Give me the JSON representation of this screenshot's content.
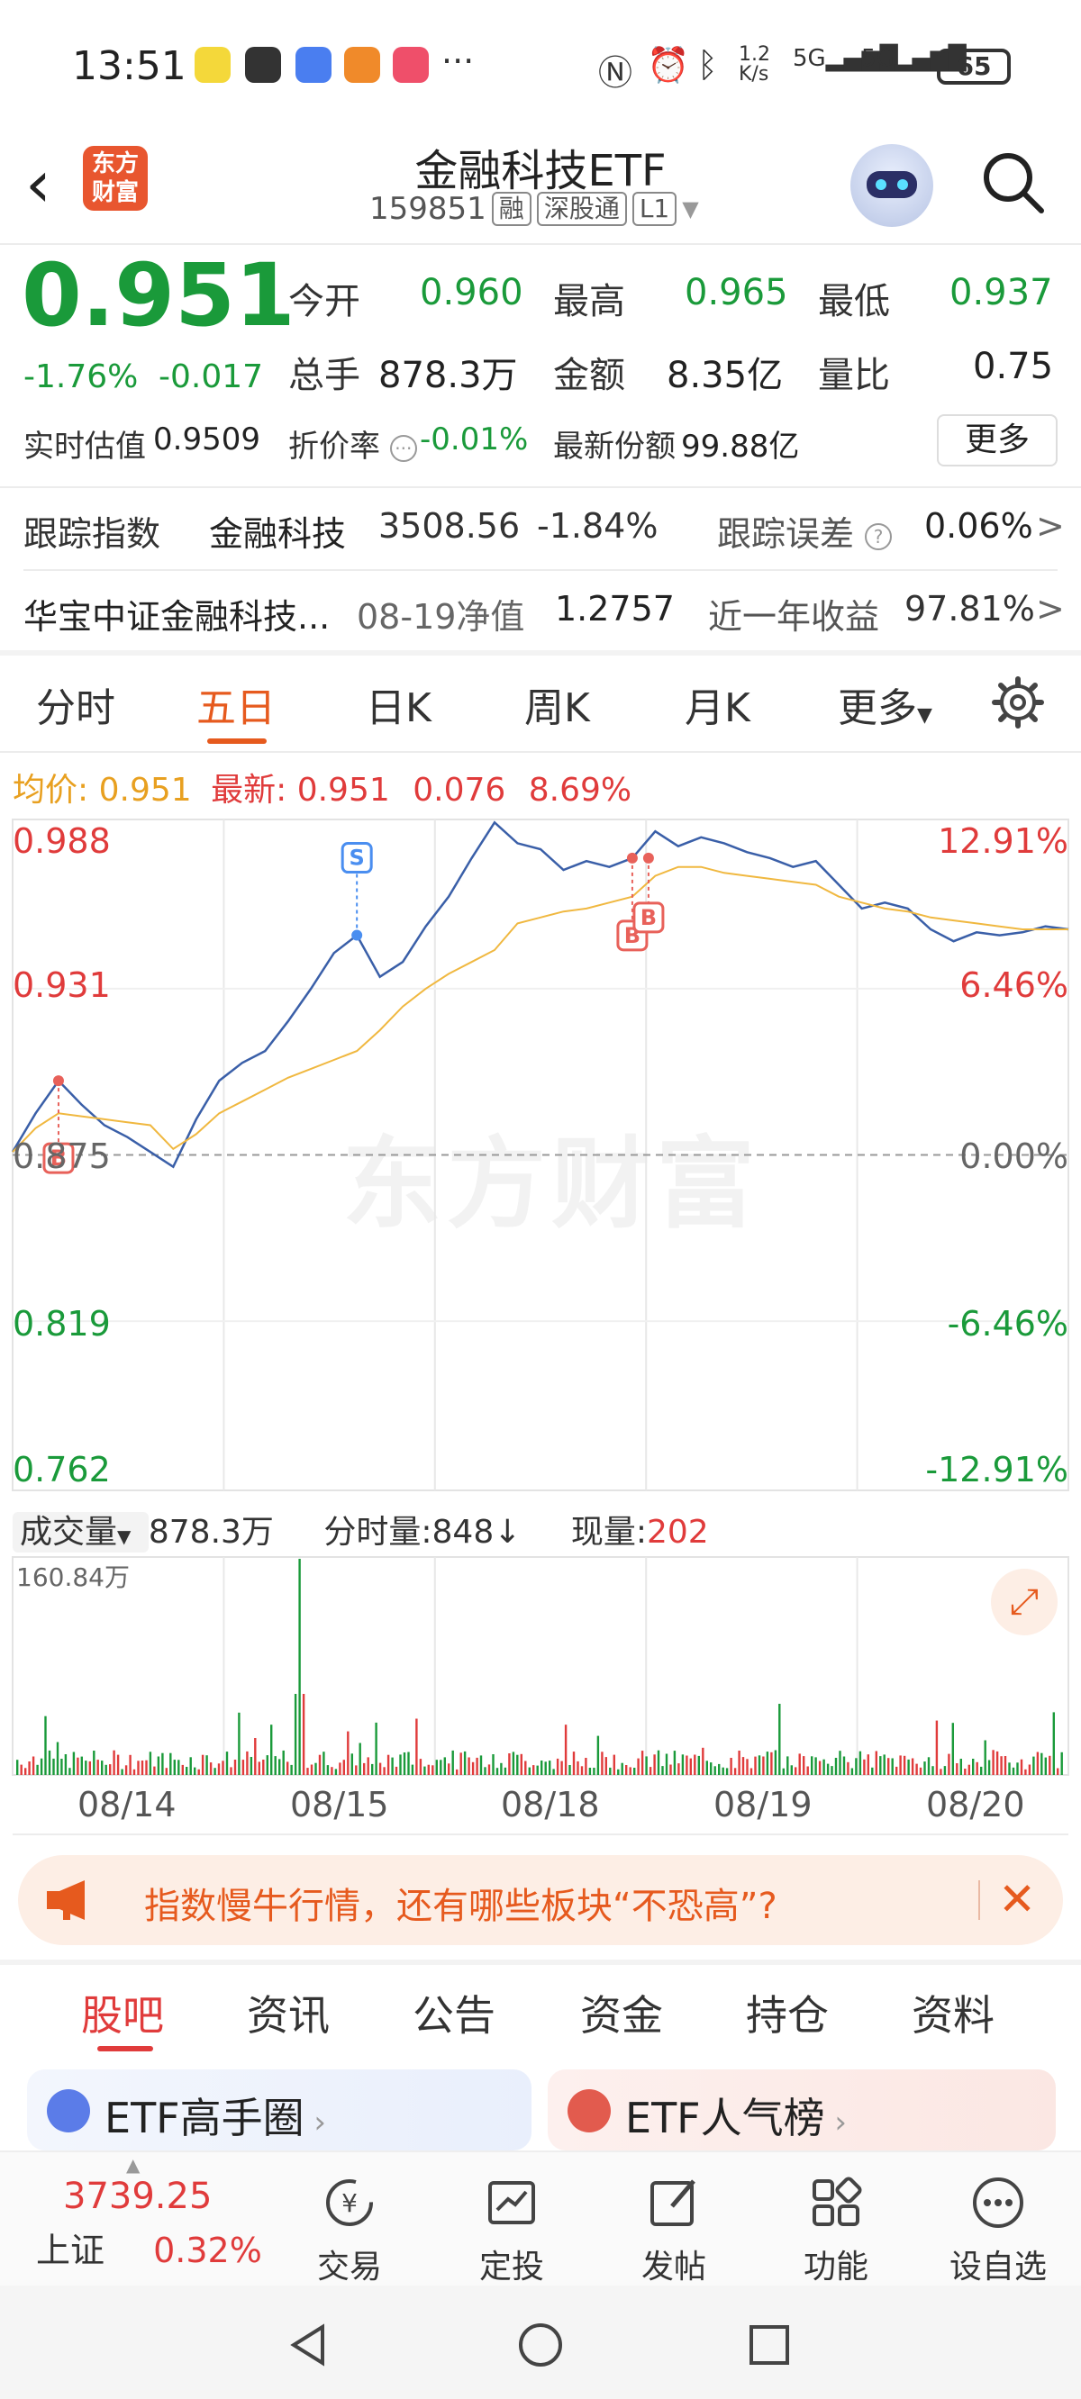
{
  "status_bar": {
    "time": "13:51",
    "network_speed": "1.2\nK/s",
    "signal1": "5G",
    "signal2": "5G",
    "battery": "65",
    "more": "···"
  },
  "header": {
    "back_icon": "‹",
    "logo_text": "东方\n财富",
    "title": "金融科技ETF",
    "code": "159851",
    "tags": [
      "融",
      "深股通",
      "L1"
    ]
  },
  "quote": {
    "price": "0.951",
    "change_pct": "-1.76%",
    "change_amt": "-0.017",
    "open_label": "今开",
    "open": "0.960",
    "high_label": "最高",
    "high": "0.965",
    "low_label": "最低",
    "low": "0.937",
    "volume_label": "总手",
    "volume": "878.3万",
    "amount_label": "金额",
    "amount": "8.35亿",
    "ratio_label": "量比",
    "ratio": "0.75",
    "iopv_label": "实时估值",
    "iopv": "0.9509",
    "premium_label": "折价率",
    "premium": "-0.01%",
    "shares_label": "最新份额",
    "shares": "99.88亿",
    "more_label": "更多"
  },
  "tracking": {
    "label": "跟踪指数",
    "index_name": "金融科技",
    "index_value": "3508.56",
    "index_change": "-1.84%",
    "error_label": "跟踪误差",
    "error_value": "0.06%",
    "fund_name": "华宝中证金融科技...",
    "nav_label": "08-19净值",
    "nav_value": "1.2757",
    "yearly_label": "近一年收益",
    "yearly_value": "97.81%",
    "arrow": ">"
  },
  "period_tabs": [
    "分时",
    "五日",
    "日K",
    "周K",
    "月K",
    "更多"
  ],
  "chart_info": {
    "avg_label": "均价:",
    "avg": "0.951",
    "latest_label": "最新:",
    "latest": "0.951",
    "latest_chg": "0.076",
    "latest_pct": "8.69%"
  },
  "chart_data": {
    "type": "line",
    "y_left_ticks": [
      "0.988",
      "0.931",
      "0.875",
      "0.819",
      "0.762"
    ],
    "y_right_ticks": [
      "12.91%",
      "6.46%",
      "0.00%",
      "-6.46%",
      "-12.91%"
    ],
    "ylim": [
      0.762,
      0.988
    ],
    "base": 0.875,
    "x_dates": [
      "08/14",
      "08/15",
      "08/18",
      "08/19",
      "08/20"
    ],
    "series": [
      {
        "values": [
          0.876,
          0.889,
          0.9,
          0.892,
          0.885,
          0.881,
          0.876,
          0.871,
          0.887,
          0.9,
          0.906,
          0.91,
          0.92,
          0.931,
          0.943,
          0.949,
          0.935,
          0.94,
          0.952,
          0.962,
          0.975,
          0.987,
          0.98,
          0.978,
          0.971,
          0.974,
          0.972,
          0.975,
          0.984,
          0.979,
          0.982,
          0.98,
          0.977,
          0.975,
          0.972,
          0.974,
          0.966,
          0.958,
          0.96,
          0.958,
          0.951,
          0.947,
          0.95,
          0.949,
          0.95,
          0.952,
          0.951
        ]
      },
      {
        "values": [
          0.876,
          0.884,
          0.889,
          0.888,
          0.887,
          0.886,
          0.885,
          0.877,
          0.882,
          0.889,
          0.893,
          0.897,
          0.901,
          0.904,
          0.907,
          0.91,
          0.917,
          0.925,
          0.931,
          0.936,
          0.94,
          0.944,
          0.953,
          0.955,
          0.957,
          0.958,
          0.96,
          0.962,
          0.969,
          0.972,
          0.972,
          0.97,
          0.969,
          0.968,
          0.967,
          0.966,
          0.962,
          0.96,
          0.958,
          0.957,
          0.955,
          0.954,
          0.953,
          0.952,
          0.951,
          0.951,
          0.951
        ]
      }
    ],
    "markers": [
      "B",
      "S",
      "B",
      "B"
    ]
  },
  "volume_info": {
    "label": "成交量",
    "total": "878.3万",
    "tick_label": "分时量:848↓",
    "now_label": "现量:",
    "now": "202",
    "max": "160.84万"
  },
  "banner": {
    "text": "指数慢牛行情，还有哪些板块“不恐高”?"
  },
  "section_tabs": [
    "股吧",
    "资讯",
    "公告",
    "资金",
    "持仓",
    "资料"
  ],
  "cards": [
    "ETF高手圈",
    "ETF人气榜"
  ],
  "bottom_bar": {
    "index_value": "3739.25",
    "index_name": "上证",
    "index_pct": "0.32%",
    "items": [
      "交易",
      "定投",
      "发帖",
      "功能",
      "设自选"
    ]
  },
  "colors": {
    "up": "#e03b3b",
    "down": "#1a9a3a",
    "accent": "#e65a1e",
    "price_line": "#3a5fa8",
    "avg_line": "#f0b840"
  }
}
